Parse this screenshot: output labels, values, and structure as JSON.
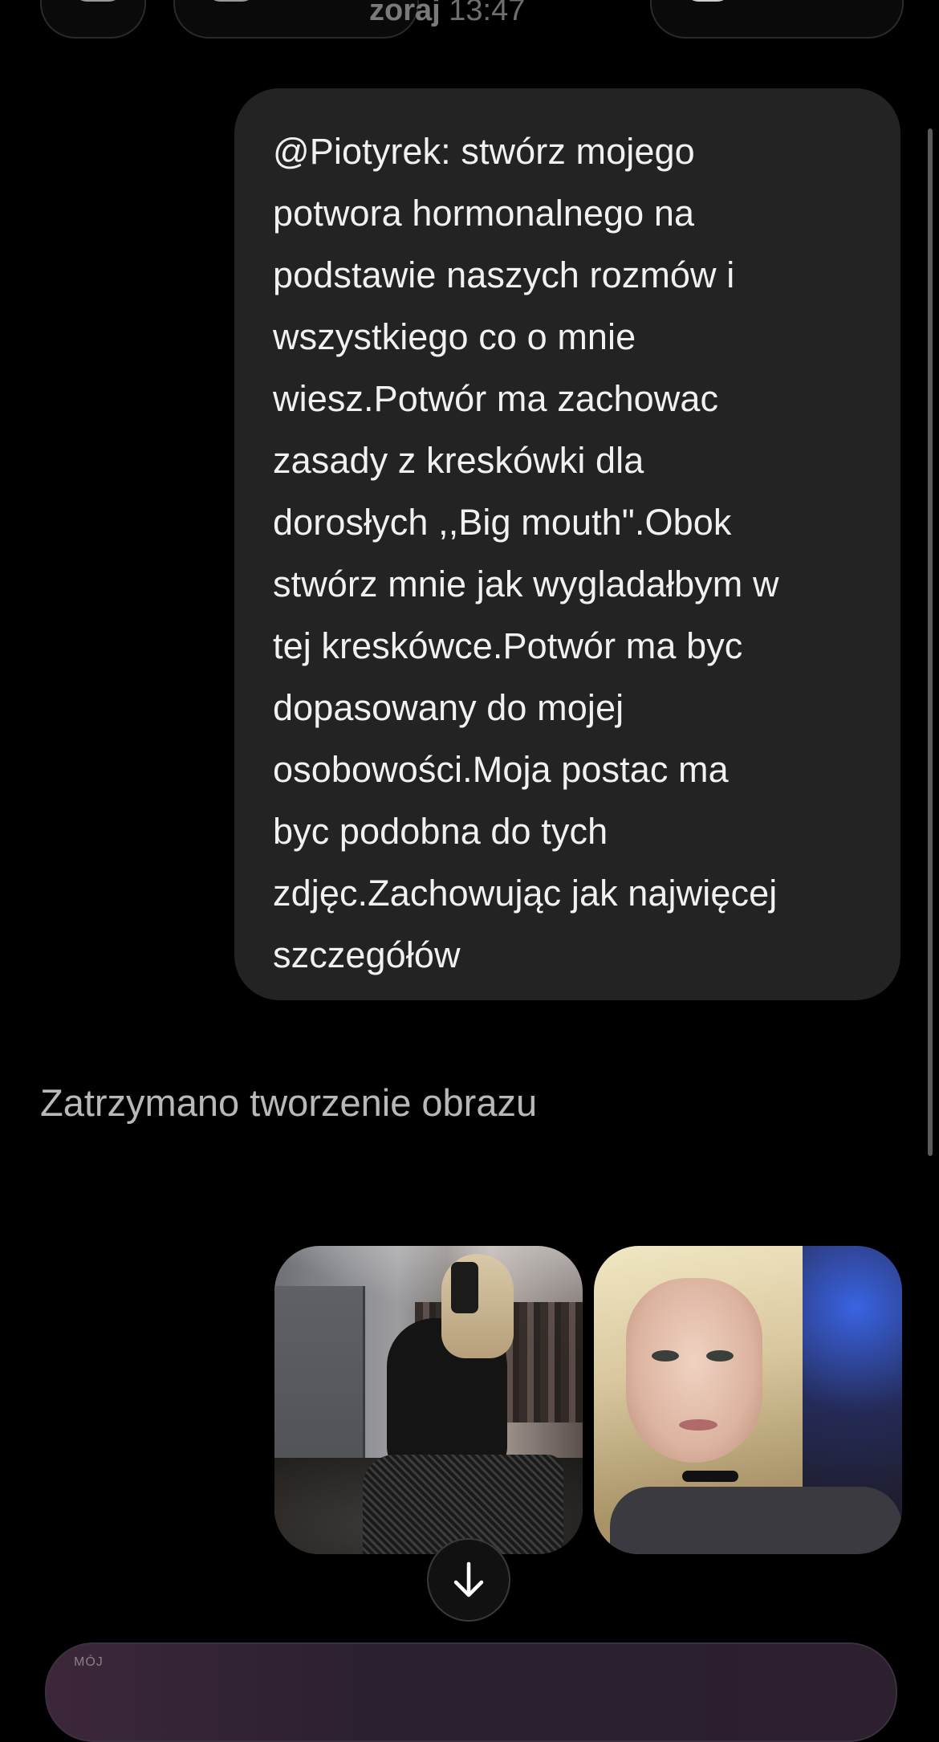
{
  "header": {
    "timestamp_day": "zoraj",
    "timestamp_time": "13:47"
  },
  "conversation": {
    "user_message": "@Piotyrek: stwórz mojego\npotwora hormonalnego na\npodstawie naszych rozmów i\nwszystkiego co o mnie\nwiesz.Potwór ma zachowac\nzasady z kreskówki dla\ndorosłych ,,Big mouth\".Obok\nstwórz mnie jak wygladałbym w\ntej kreskówce.Potwór ma byc\ndopasowany do mojej\nosobowości.Moja postac ma\nbyc podobna do tych\nzdjęc.Zachowując jak najwięcej\nszczegółów",
    "assistant_status": "Zatrzymano tworzenie obrazu",
    "attachments": [
      {
        "type": "photo",
        "subject": "mirror-selfie"
      },
      {
        "type": "photo",
        "subject": "portrait-selfie"
      }
    ]
  },
  "composer": {
    "label": "MÓJ"
  },
  "icons": {
    "scroll_down": "arrow-down-icon"
  }
}
